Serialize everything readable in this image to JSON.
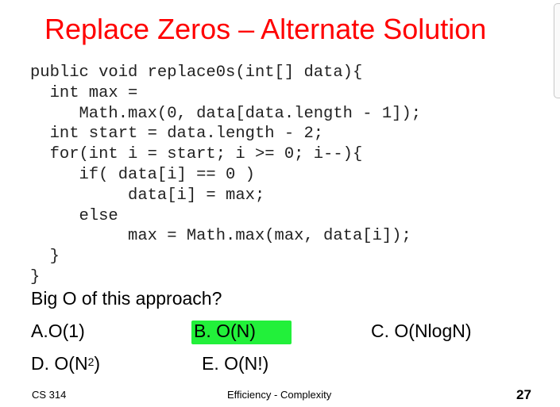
{
  "slide": {
    "title": "Replace Zeros – Alternate Solution",
    "code_lines": [
      "public void replace0s(int[] data){",
      "  int max =",
      "     Math.max(0, data[data.length - 1]);",
      "  int start = data.length - 2;",
      "  for(int i = start; i >= 0; i--){",
      "     if( data[i] == 0 )",
      "          data[i] = max;",
      "     else",
      "          max = Math.max(max, data[i]);",
      "  }",
      "}"
    ],
    "question": "Big O of this approach?",
    "options": {
      "a": "A.O(1)",
      "b": "B.  O(N)",
      "c": "C. O(NlogN)",
      "d_prefix": "D. O(N",
      "d_sup": "2",
      "d_suffix": ")",
      "e": "E. O(N!)"
    },
    "highlight_color": "#22f03a",
    "title_color": "#ff0000"
  },
  "footer": {
    "course": "CS 314",
    "topic": "Efficiency - Complexity",
    "page_number": "27"
  }
}
